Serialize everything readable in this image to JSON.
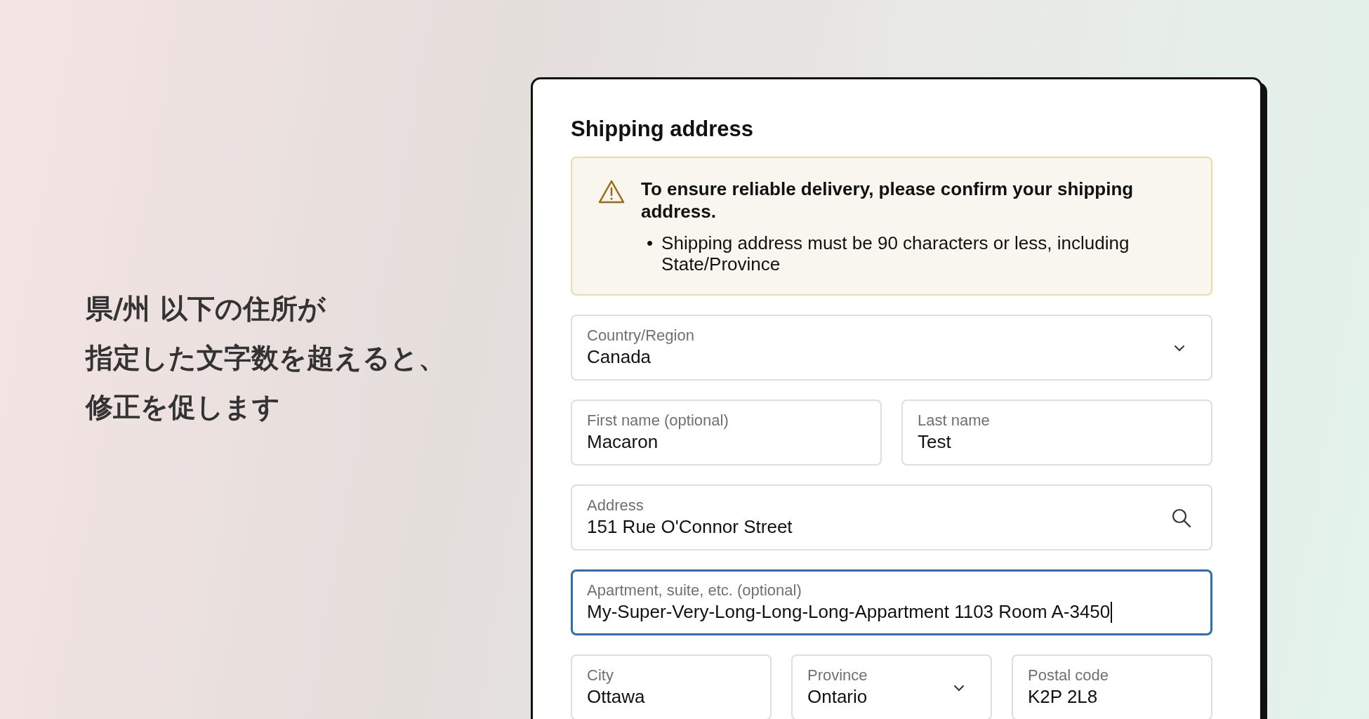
{
  "headline": [
    "県/州 以下の住所が",
    "指定した文字数を超えると、",
    "修正を促します"
  ],
  "form": {
    "title": "Shipping address",
    "alert": {
      "title": "To ensure reliable delivery, please confirm your shipping address.",
      "items": [
        {
          "bullet": "•",
          "text": "Shipping address must be 90 characters or less, including State/Province"
        }
      ]
    },
    "rows": [
      [
        {
          "kind": "select",
          "label": "Country/Region",
          "value": "Canada",
          "focused": false
        }
      ],
      [
        {
          "kind": "text",
          "label": "First name (optional)",
          "value": "Macaron",
          "focused": false
        },
        {
          "kind": "text",
          "label": "Last name",
          "value": "Test",
          "focused": false
        }
      ],
      [
        {
          "kind": "search",
          "label": "Address",
          "value": "151 Rue O'Connor Street",
          "focused": false
        }
      ],
      [
        {
          "kind": "text",
          "label": "Apartment, suite, etc. (optional)",
          "value": "My-Super-Very-Long-Long-Long-Appartment 1103 Room A-3450",
          "focused": true
        }
      ],
      [
        {
          "kind": "text",
          "label": "City",
          "value": "Ottawa",
          "focused": false
        },
        {
          "kind": "select",
          "label": "Province",
          "value": "Ontario",
          "focused": false
        },
        {
          "kind": "text",
          "label": "Postal code",
          "value": "K2P 2L8",
          "focused": false
        }
      ]
    ]
  }
}
